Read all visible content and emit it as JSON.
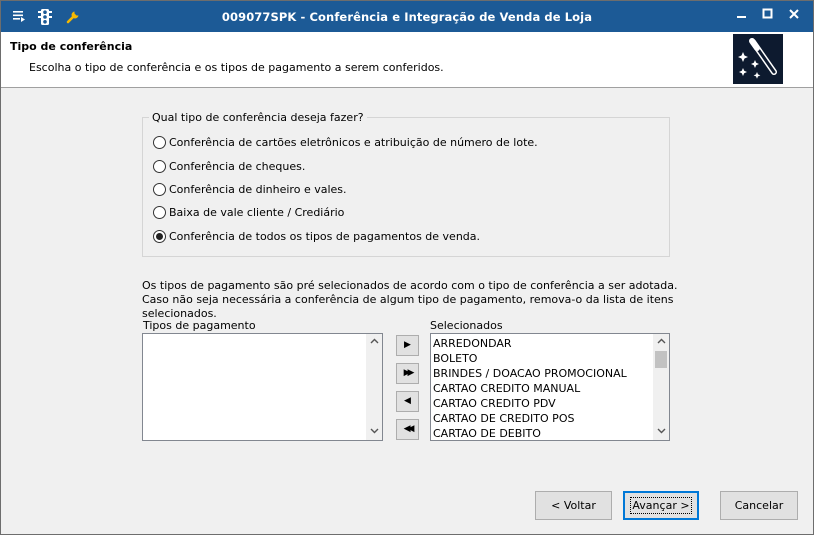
{
  "window": {
    "title": "009077SPK - Conferência e Integração de Venda de Loja",
    "minimize": "▬",
    "maximize": "▢",
    "close": "✕"
  },
  "header": {
    "title": "Tipo de conferência",
    "subtitle": "Escolha o tipo de conferência e os tipos de pagamento a serem conferidos."
  },
  "group": {
    "label": "Qual tipo de conferência deseja fazer?",
    "options": [
      {
        "label": "Conferência de cartões eletrônicos e atribuição de número de lote.",
        "checked": false
      },
      {
        "label": "Conferência de cheques.",
        "checked": false
      },
      {
        "label": "Conferência de dinheiro e vales.",
        "checked": false
      },
      {
        "label": "Baixa de vale cliente / Crediário",
        "checked": false
      },
      {
        "label": "Conferência de todos os tipos de pagamentos de venda.",
        "checked": true
      }
    ]
  },
  "info": "Os tipos de pagamento são pré selecionados de acordo com o tipo de conferência a ser adotada. Caso não seja necessária a conferência de algum tipo de pagamento, remova-o da lista de itens selecionados.",
  "available": {
    "label": "Tipos de pagamento",
    "items": []
  },
  "selected": {
    "label": "Selecionados",
    "items": [
      "ARREDONDAR",
      "BOLETO",
      "BRINDES / DOACAO PROMOCIONAL",
      "CARTAO CREDITO MANUAL",
      "CARTAO CREDITO PDV",
      "CARTAO DE CREDITO POS",
      "CARTAO DE DEBITO"
    ]
  },
  "move_buttons": {
    "add": "▶",
    "add_all": "▶▶",
    "remove": "◀",
    "remove_all": "◀◀"
  },
  "buttons": {
    "back": "< Voltar",
    "next": "Avançar >",
    "cancel": "Cancelar"
  },
  "colors": {
    "titlebar": "#1c5a96",
    "default_button_border": "#0078d7"
  }
}
